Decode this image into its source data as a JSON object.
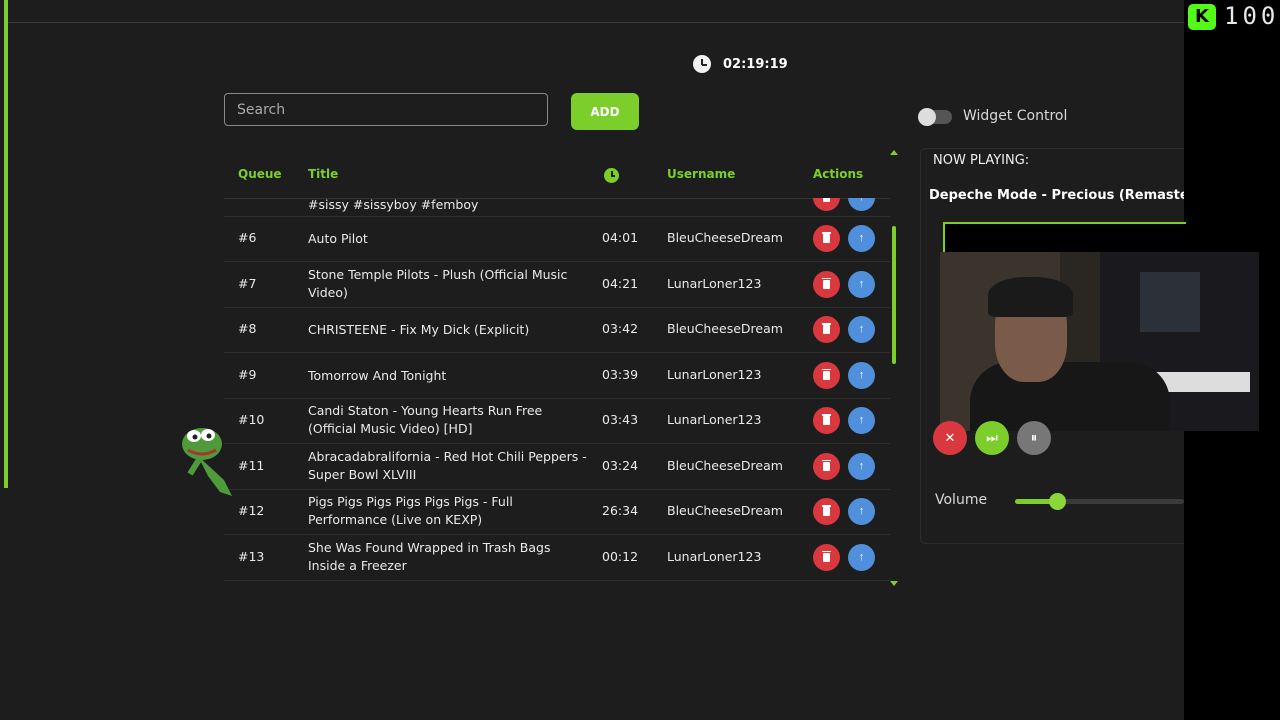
{
  "clock": {
    "time": "02:19:19"
  },
  "search": {
    "placeholder": "Search"
  },
  "add_label": "ADD",
  "table": {
    "headers": {
      "queue": "Queue",
      "title": "Title",
      "username": "Username",
      "actions": "Actions"
    },
    "partial_row_title": "#sissy #sissyboy #femboy",
    "rows": [
      {
        "queue": "#6",
        "title": "Auto Pilot",
        "duration": "04:01",
        "username": "BleuCheeseDream"
      },
      {
        "queue": "#7",
        "title": "Stone Temple Pilots - Plush (Official Music Video)",
        "duration": "04:21",
        "username": "LunarLoner123"
      },
      {
        "queue": "#8",
        "title": "CHRISTEENE - Fix My Dick (Explicit)",
        "duration": "03:42",
        "username": "BleuCheeseDream"
      },
      {
        "queue": "#9",
        "title": "Tomorrow And Tonight",
        "duration": "03:39",
        "username": "LunarLoner123"
      },
      {
        "queue": "#10",
        "title": "Candi Staton - Young Hearts Run Free (Official Music Video) [HD]",
        "duration": "03:43",
        "username": "LunarLoner123"
      },
      {
        "queue": "#11",
        "title": "Abracadabralifornia - Red Hot Chili Peppers - Super Bowl XLVIII",
        "duration": "03:24",
        "username": "BleuCheeseDream"
      },
      {
        "queue": "#12",
        "title": "Pigs Pigs Pigs Pigs Pigs Pigs - Full Performance (Live on KEXP)",
        "duration": "26:34",
        "username": "BleuCheeseDream"
      },
      {
        "queue": "#13",
        "title": "She Was Found Wrapped in Trash Bags Inside a Freezer",
        "duration": "00:12",
        "username": "LunarLoner123"
      }
    ]
  },
  "widget": {
    "label": "Widget Control",
    "enabled": false
  },
  "now_playing": {
    "label": "NOW PLAYING:",
    "title": "Depeche Mode - Precious (Remastered)"
  },
  "volume": {
    "label": "Volume",
    "level": 0.25
  },
  "stream_overlay": {
    "count": "100"
  },
  "colors": {
    "accent": "#7ccf2a",
    "delete": "#d9383f",
    "promote": "#4f8fdc"
  }
}
